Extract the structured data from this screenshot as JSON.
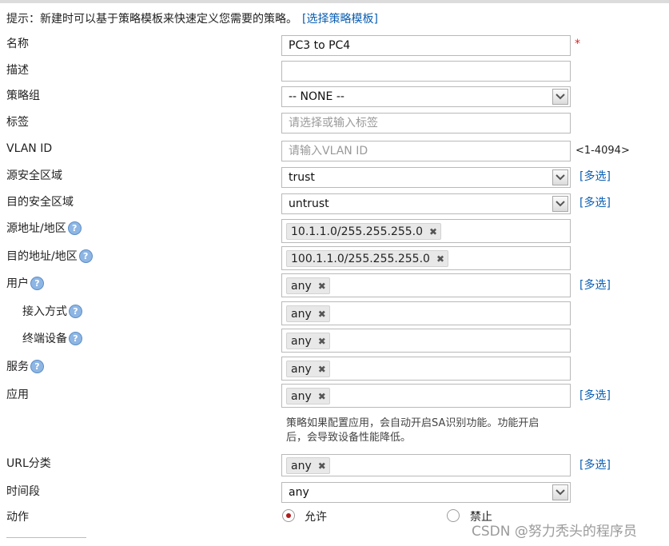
{
  "hint": {
    "text": "提示：新建时可以基于策略模板来快速定义您需要的策略。",
    "link": "[选择策略模板]"
  },
  "fields": {
    "name": {
      "label": "名称",
      "value": "PC3 to PC4",
      "required_mark": "*"
    },
    "description": {
      "label": "描述",
      "value": ""
    },
    "policy_group": {
      "label": "策略组",
      "value": "-- NONE --"
    },
    "tag": {
      "label": "标签",
      "placeholder": "请选择或输入标签"
    },
    "vlan_id": {
      "label": "VLAN ID",
      "placeholder": "请输入VLAN ID",
      "range": "<1-4094>"
    },
    "src_zone": {
      "label": "源安全区域",
      "value": "trust",
      "multi": "[多选]"
    },
    "dst_zone": {
      "label": "目的安全区域",
      "value": "untrust",
      "multi": "[多选]"
    },
    "src_addr": {
      "label": "源地址/地区",
      "chip": "10.1.1.0/255.255.255.0"
    },
    "dst_addr": {
      "label": "目的地址/地区",
      "chip": "100.1.1.0/255.255.255.0"
    },
    "user": {
      "label": "用户",
      "chip": "any",
      "multi": "[多选]"
    },
    "access_mode": {
      "label": "接入方式",
      "chip": "any"
    },
    "terminal": {
      "label": "终端设备",
      "chip": "any"
    },
    "service": {
      "label": "服务",
      "chip": "any"
    },
    "application": {
      "label": "应用",
      "chip": "any",
      "multi": "[多选]",
      "note_line1": "策略如果配置应用，会自动开启SA识别功能。功能开启",
      "note_line2": "后，会导致设备性能降低。"
    },
    "url_category": {
      "label": "URL分类",
      "chip": "any",
      "multi": "[多选]"
    },
    "time_range": {
      "label": "时间段",
      "value": "any"
    },
    "action": {
      "label": "动作",
      "allow": "允许",
      "deny": "禁止",
      "selected": "允许"
    }
  },
  "help_symbol": "?",
  "chip_close": "✖",
  "watermark": "CSDN @努力秃头的程序员",
  "colors": {
    "link": "#0b5fb3",
    "required": "#e02020",
    "radio_selected": "#b01c1c"
  }
}
